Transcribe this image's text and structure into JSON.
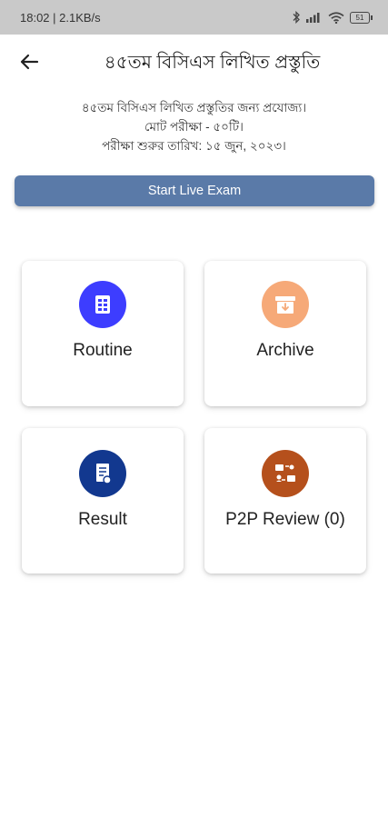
{
  "status_bar": {
    "time_speed": "18:02 | 2.1KB/s",
    "battery": "51"
  },
  "header": {
    "title": "৪৫তম বিসিএস লিখিত প্রস্তুতি"
  },
  "description": {
    "line1": "৪৫তম বিসিএস লিখিত প্রস্তুতির জন্য প্রযোজ্য।",
    "line2": "মোট পরীক্ষা - ৫০টি।",
    "line3": "পরীক্ষা শুরুর তারিখ: ১৫ জুন, ২০২৩।"
  },
  "live_exam_button": {
    "label": "Start Live Exam",
    "color": "#5a7aa8"
  },
  "cards": [
    {
      "label": "Routine",
      "icon": "routine-icon",
      "color": "#3d3dff"
    },
    {
      "label": "Archive",
      "icon": "archive-icon",
      "color": "#f6a978"
    },
    {
      "label": "Result",
      "icon": "result-icon",
      "color": "#12388f"
    },
    {
      "label": "P2P Review (0)",
      "icon": "p2p-review-icon",
      "color": "#b5501c"
    }
  ]
}
